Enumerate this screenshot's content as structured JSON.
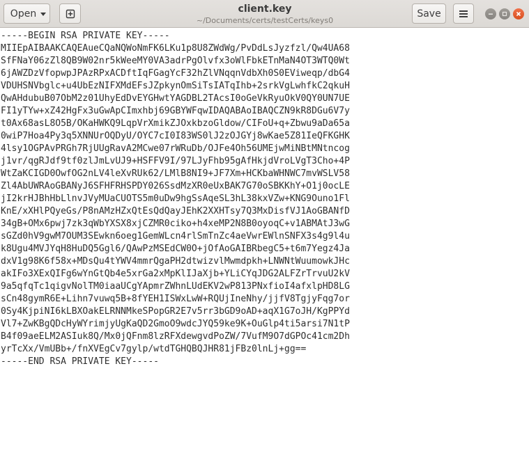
{
  "header": {
    "open_label": "Open",
    "title": "client.key",
    "subtitle": "~/Documents/certs/testCerts/keys0",
    "save_label": "Save"
  },
  "icons": {
    "open_dropdown": "chevron-down-icon",
    "new_document": "new-document-icon",
    "menu": "hamburger-menu-icon",
    "minimize": "minimize-icon",
    "maximize": "maximize-icon",
    "close": "close-icon"
  },
  "colors": {
    "close_button": "#e9602f",
    "headerbar": "#dfdbd8"
  },
  "editor": {
    "lines": [
      "-----BEGIN RSA PRIVATE KEY-----",
      "MIIEpAIBAAKCAQEAueCQaNQWoNmFK6LKu1p8U8ZWdWg/PvDdLsJyzfzl/Qw4UA68",
      "SfFNaY06zZl8QB9W02nr5kWeeMY0VA3adrPgOlvfx3oWlFbkETnMaN4OT3WTQ0Wt",
      "6jAWZDzVfopwpJPAzRPxACDftIqFGagYcF32hZlVNqqnVdbXh0S0EViweqp/dbG4",
      "VDUHSNVbglc+u4UbEzNIFXMdEFsJZpkynOmSiTsIATqIhb+2srkVgLwhfkC2qkuH",
      "QwAHdubuB07ObM2z01UhyEdDvEYGHwtYAGDBL2TAcsI0oGeVkRyuOkV0QY0UN7UE",
      "FI1yTYw+xZ42HgFx3uGwApCImxhbj69GBYWFqwIDAQABAoIBAQCZN9kR8DGu6V7y",
      "t0Ax68asL8O5B/OKaHWKQ9LqpVrXmikZJOxkbzoGldow/CIFoU+q+Zbwu9aDa65a",
      "0wiP7Hoa4Py3q5XNNUrOQDyU/OYC7cI0I83WS0lJ2zOJGYj8wKae5Z81IeQFKGHK",
      "4lsy1OGPAvPRGh7RjUUgRavA2MCwe07rWRuDb/OJFe4Oh56UMEjwMiNBtMNtncog",
      "j1vr/qgRJdf9tf0zlJmLvUJ9+HSFFV9I/97LJyFhb95gAfHkjdVroLVgT3Cho+4P",
      "WtZaKCIGD0OwfOG2nLV4leXvRUk62/LMlB8NI9+JF7Xm+HCKbaWHNWC7mvWSLV58",
      "Zl4AbUWRAoGBANyJ6SFHFRHSPDY026SsdMzXR0eUxBAK7G70oSBKKhY+O1j0ocLE",
      "jI2krHJBhHbLlnvJVyMUaCUOTS5m0uDw9hgSsAqeSL3hL38kxVZw+KNG9Ouno1Fl",
      "KnE/xXHlPQyeGs/P8nAMzHZxQtEsQdQayJEhK2XXHTsy7Q3MxDisfVJ1AoGBANfD",
      "34gB+OMx6pwj7zk3qWbYXSX8xjCZMR0ciko+h4xeMP2N8B0oyoqC+v1ABMAtJ3wG",
      "sGZd0hV9gwM7OUM3SEwkn6oeg1GemWLcn4rlSmTnZc4aeVwrEWlnSNFX3s4g9l4u",
      "k8Ugu4MVJYqH8HuDQ5Ggl6/QAwPzMSEdCW0O+jOfAoGAIBRbegC5+t6m7Yegz4Ja",
      "dxV1g98K6f58x+MDsQu4tYWV4mmrQgaPH2dtwizvlMwmdpkh+LNWNtWuumowkJHc",
      "akIFo3XExQIFg6wYnGtQb4e5xrGa2xMpKlIJaXjb+YLiCYqJDG2ALFZrTrvuU2kV",
      "9a5qfqTc1qigvNolTM0iaaUCgYApmrZWhnLUdEKV2wP813PNxfioI4afxlpHD8LG",
      "sCn48gymR6E+Lihn7vuwq5B+8fYEH1ISWxLwW+RQUjIneNhy/jjfV8TgjyFqg7or",
      "0Sy4KjpiNI6kLBXOakELRNNMkeSPopGR2E7v5rr3bGD9oAD+aqX1G7oJH/KgPPYd",
      "Vl7+ZwKBgQDcHyWYrimjyUgKaQD2GmoO9wdcJYQ59ke9K+OuGlp4ti5arsi7N1tP",
      "B4f09aeELM2ASIuk8Q/Mx0jQFnm8lzRFXdewgvdPoZW/7VufM9O7dGPOc41cm2Dh",
      "yrTcXx/VmUBb+/fnXVEgCv7gylp/wtdTGHQBQJHR81jFBz0lnLj+gg==",
      "-----END RSA PRIVATE KEY-----"
    ]
  }
}
